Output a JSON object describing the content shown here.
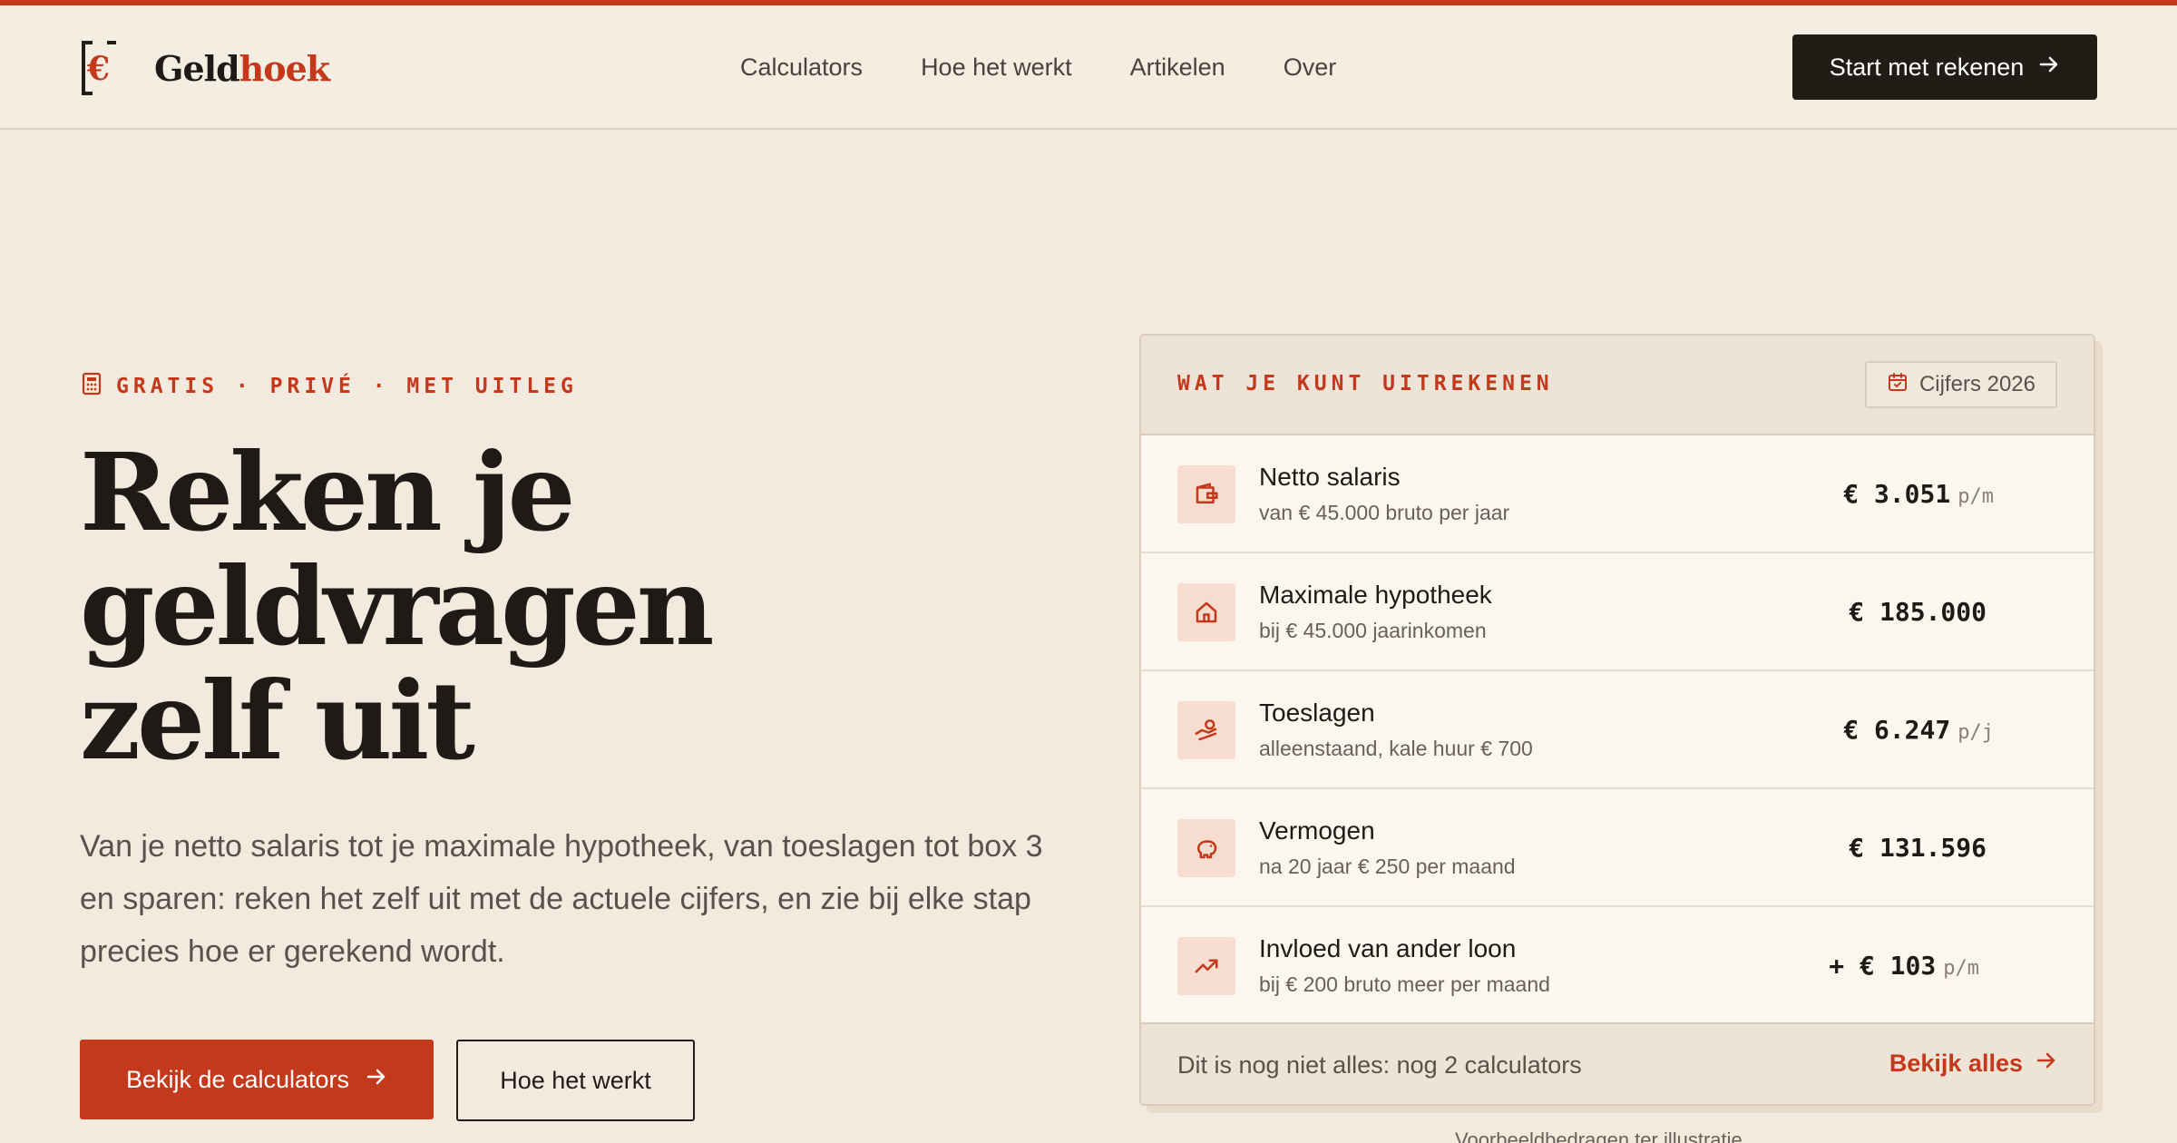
{
  "brand": {
    "part1": "Geld",
    "part2": "hoek",
    "accent_color": "#c4391b",
    "dark_color": "#221c17"
  },
  "nav": {
    "items": [
      "Calculators",
      "Hoe het werkt",
      "Artikelen",
      "Over"
    ]
  },
  "header_cta": {
    "label": "Start met rekenen",
    "icon": "arrow-right-icon"
  },
  "hero": {
    "eyebrow": "GRATIS · PRIVÉ · MET UITLEG",
    "headline_lines": [
      "Reken je",
      "geldvragen",
      "zelf uit"
    ],
    "lead": "Van je netto salaris tot je maximale hypotheek, van toeslagen tot box 3 en sparen: reken het zelf uit met de actuele cijfers, en zie bij elke stap precies hoe er gerekend wordt.",
    "primary_button": "Bekijk de calculators",
    "secondary_button": "Hoe het werkt"
  },
  "card": {
    "title": "WAT JE KUNT UITREKENEN",
    "badge": "Cijfers 2026",
    "rows": [
      {
        "icon": "wallet-icon",
        "title": "Netto salaris",
        "sub": "van € 45.000 bruto per jaar",
        "value": "€ 3.051",
        "unit": "p/m"
      },
      {
        "icon": "house-icon",
        "title": "Maximale hypotheek",
        "sub": "bij € 45.000 jaarinkomen",
        "value": "€ 185.000",
        "unit": ""
      },
      {
        "icon": "hand-coins-icon",
        "title": "Toeslagen",
        "sub": "alleenstaand, kale huur € 700",
        "value": "€ 6.247",
        "unit": "p/j"
      },
      {
        "icon": "piggy-bank-icon",
        "title": "Vermogen",
        "sub": "na 20 jaar € 250 per maand",
        "value": "€ 131.596",
        "unit": ""
      },
      {
        "icon": "trending-up-icon",
        "title": "Invloed van ander loon",
        "sub": "bij € 200 bruto meer per maand",
        "value": "+ € 103",
        "unit": "p/m"
      }
    ],
    "footer_text": "Dit is nog niet alles: nog 2 calculators",
    "footer_link": "Bekijk alles"
  },
  "note": "Voorbeeldbedragen ter illustratie"
}
